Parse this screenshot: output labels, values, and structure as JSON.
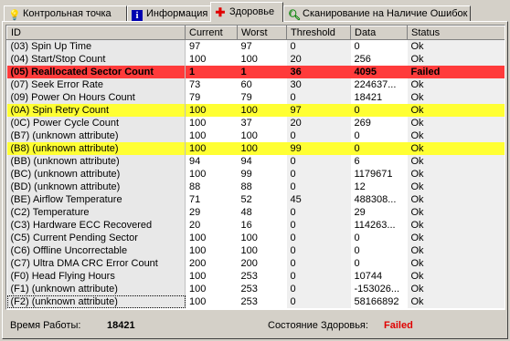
{
  "tabs": [
    {
      "label": "Контрольная точка",
      "icon": "bulb-icon"
    },
    {
      "label": "Информация",
      "icon": "info-icon"
    },
    {
      "label": "Здоровье",
      "icon": "red-cross-icon"
    },
    {
      "label": "Сканирование на Наличие Ошибок",
      "icon": "magnifier-icon"
    }
  ],
  "active_tab": 2,
  "columns": [
    "ID",
    "Current",
    "Worst",
    "Threshold",
    "Data",
    "Status"
  ],
  "rows": [
    [
      "(03) Spin Up Time",
      "97",
      "97",
      "0",
      "0",
      "Ok"
    ],
    [
      "(04) Start/Stop Count",
      "100",
      "100",
      "20",
      "256",
      "Ok"
    ],
    [
      "(05) Reallocated Sector Count",
      "1",
      "1",
      "36",
      "4095",
      "Failed"
    ],
    [
      "(07) Seek Error Rate",
      "73",
      "60",
      "30",
      "224637...",
      "Ok"
    ],
    [
      "(09) Power On Hours Count",
      "79",
      "79",
      "0",
      "18421",
      "Ok"
    ],
    [
      "(0A) Spin Retry Count",
      "100",
      "100",
      "97",
      "0",
      "Ok"
    ],
    [
      "(0C) Power Cycle Count",
      "100",
      "37",
      "20",
      "269",
      "Ok"
    ],
    [
      "(B7) (unknown attribute)",
      "100",
      "100",
      "0",
      "0",
      "Ok"
    ],
    [
      "(B8) (unknown attribute)",
      "100",
      "100",
      "99",
      "0",
      "Ok"
    ],
    [
      "(BB) (unknown attribute)",
      "94",
      "94",
      "0",
      "6",
      "Ok"
    ],
    [
      "(BC) (unknown attribute)",
      "100",
      "99",
      "0",
      "1179671",
      "Ok"
    ],
    [
      "(BD) (unknown attribute)",
      "88",
      "88",
      "0",
      "12",
      "Ok"
    ],
    [
      "(BE) Airflow Temperature",
      "71",
      "52",
      "45",
      "488308...",
      "Ok"
    ],
    [
      "(C2) Temperature",
      "29",
      "48",
      "0",
      "29",
      "Ok"
    ],
    [
      "(C3) Hardware ECC Recovered",
      "20",
      "16",
      "0",
      "114263...",
      "Ok"
    ],
    [
      "(C5) Current Pending Sector",
      "100",
      "100",
      "0",
      "0",
      "Ok"
    ],
    [
      "(C6) Offline Uncorrectable",
      "100",
      "100",
      "0",
      "0",
      "Ok"
    ],
    [
      "(C7) Ultra DMA CRC Error Count",
      "200",
      "200",
      "0",
      "0",
      "Ok"
    ],
    [
      "(F0) Head Flying Hours",
      "100",
      "253",
      "0",
      "10744",
      "Ok"
    ],
    [
      "(F1) (unknown attribute)",
      "100",
      "253",
      "0",
      "-153026...",
      "Ok"
    ],
    [
      "(F2) (unknown attribute)",
      "100",
      "253",
      "0",
      "58166892",
      "Ok"
    ]
  ],
  "row_highlights": {
    "2": "red",
    "5": "yellow",
    "8": "yellow"
  },
  "selected_row": 20,
  "colors": {
    "failed_row": "#ff3b3b",
    "warning_row": "#ffff33",
    "failed_text": "#e00000",
    "window_bg": "#d4d0c8"
  },
  "footer": {
    "uptime_label": "Время Работы:",
    "uptime_value": "18421",
    "health_label": "Состояние Здоровья:",
    "health_value": "Failed"
  }
}
